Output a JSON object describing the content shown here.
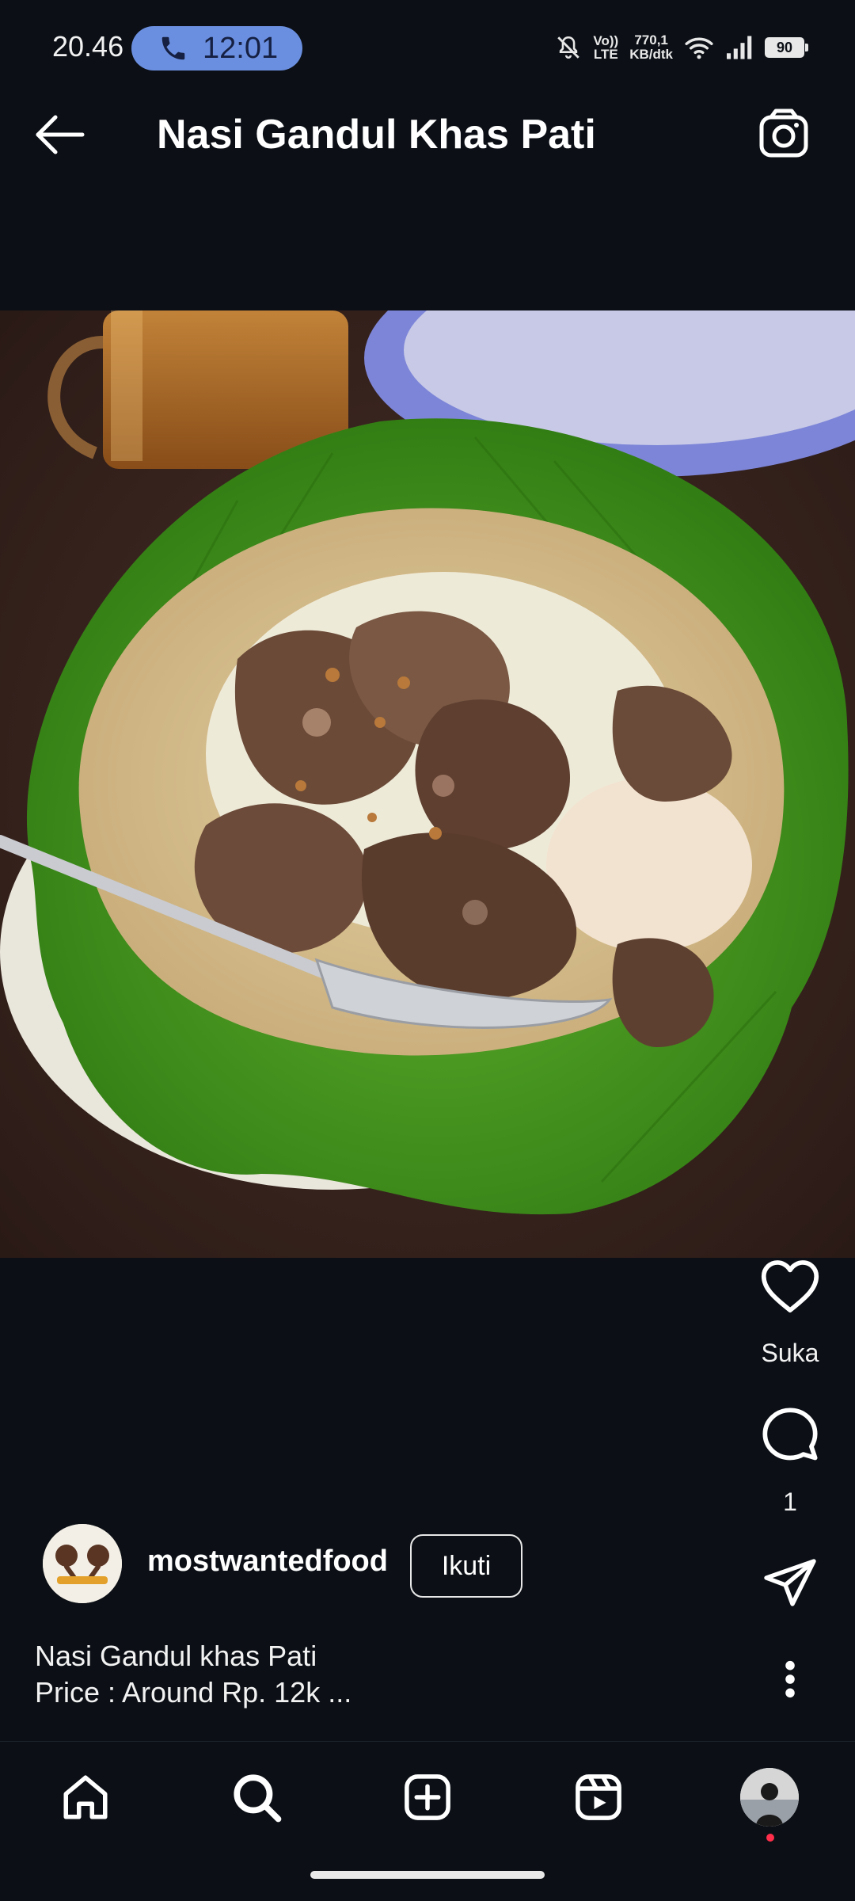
{
  "status_bar": {
    "time": "20.46",
    "call_timer": "12:01",
    "network_label_top": "Vo))",
    "network_label_bottom": "LTE",
    "speed_value": "770,1",
    "speed_unit": "KB/dtk",
    "battery": "90",
    "icons": [
      "phone-icon",
      "mute-bell-icon",
      "wifi-icon",
      "signal-icon",
      "battery-icon"
    ]
  },
  "header": {
    "title": "Nasi Gandul Khas Pati",
    "back_icon": "arrow-left-icon",
    "camera_icon": "camera-icon"
  },
  "actions": {
    "like_label": "Suka",
    "comment_count": "1",
    "icons": [
      "heart-icon",
      "comment-icon",
      "share-icon",
      "more-icon"
    ]
  },
  "post": {
    "username": "mostwantedfood",
    "follow_label": "Ikuti",
    "caption_line1": "Nasi Gandul khas Pati",
    "caption_line2": "Price : Around Rp. 12k ..."
  },
  "nav": {
    "items": [
      "home-icon",
      "search-icon",
      "create-icon",
      "reels-icon",
      "profile-avatar"
    ]
  },
  "colors": {
    "background": "#0c1016",
    "call_pill": "#6b8fe0",
    "notification_dot": "#ff2e4a"
  }
}
